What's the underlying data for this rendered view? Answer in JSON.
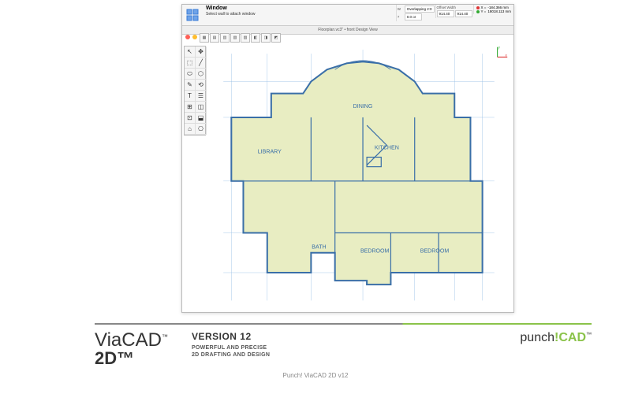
{
  "inspector": {
    "icon": "window-grid-icon",
    "title": "Window",
    "subtitle": "Select wall to attach window",
    "group1_label_a": "W",
    "group1_val_a": "Overlapping 2:0",
    "group1_label_b": "?",
    "group1_val_b": "0.0 or",
    "group2_label_a": "Offset",
    "group2_val_a": "Width",
    "group2_label_b": "914.40",
    "group2_val_b": "914.40",
    "coord_x_label": "X =",
    "coord_x_val": "-184.366 mm",
    "coord_y_label": "Y =",
    "coord_y_val": "18018.113 mm"
  },
  "document_tab": "Floorplan.vc3\" • front Design View",
  "rooms": {
    "dining": "DINING",
    "library": "LIBRARY",
    "kitchen": "KITCHEN",
    "bath": "BATH",
    "bedroom1": "BEDROOM",
    "bedroom2": "BEDROOM"
  },
  "tools": [
    "↖",
    "✥",
    "⬚",
    "╱",
    "⬭",
    "⬡",
    "✎",
    "⟲",
    "T",
    "☰",
    "⊞",
    "◫",
    "⊡",
    "⬓",
    "⌂",
    "⎔"
  ],
  "mini_toolbar": [
    "▦",
    "▤",
    "▥",
    "▧",
    "▨",
    "◧",
    "◨",
    "◩"
  ],
  "logo": {
    "brand": "ViaCAD",
    "sub": "2D",
    "tm": "™"
  },
  "version_title": "VERSION 12",
  "tagline_1": "POWERFUL AND PRECISE",
  "tagline_2": "2D DRAFTING AND DESIGN",
  "punch": {
    "p": "punch",
    "excl": "!",
    "cad": "CAD",
    "tm": "™"
  },
  "caption": "Punch! ViaCAD 2D v12"
}
